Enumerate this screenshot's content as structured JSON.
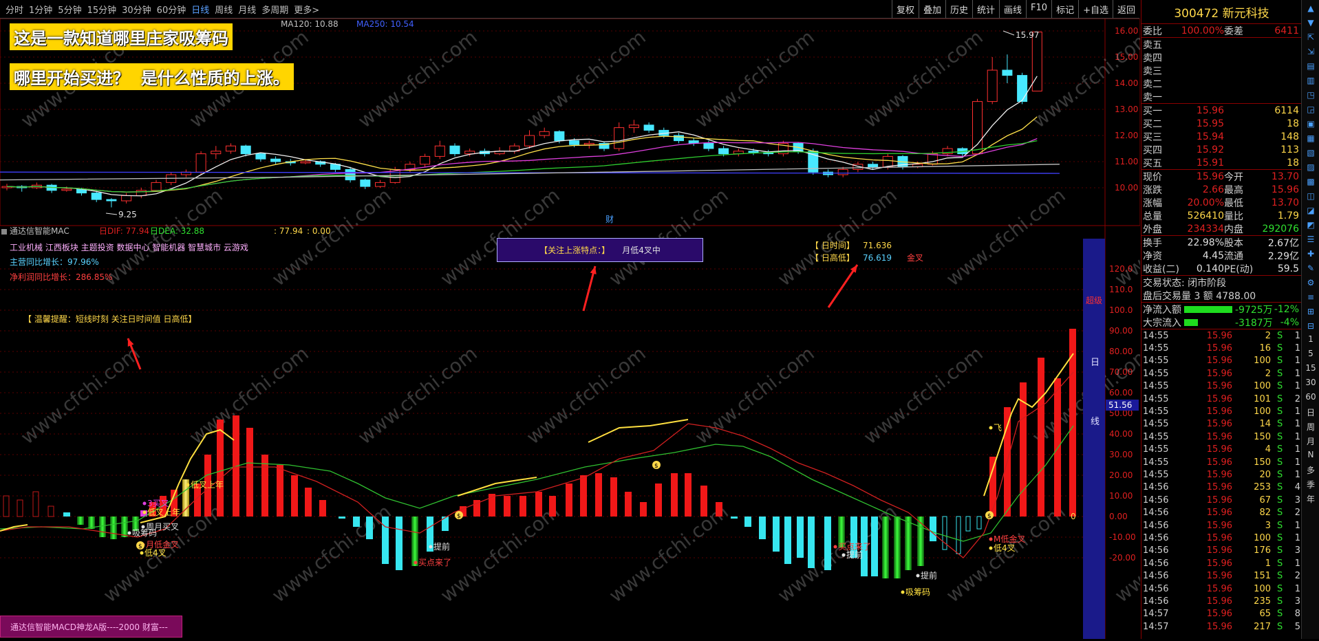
{
  "toolbar": {
    "periods": [
      "分时",
      "1分钟",
      "5分钟",
      "15分钟",
      "30分钟",
      "60分钟",
      "日线",
      "周线",
      "月线",
      "多周期",
      "更多>"
    ],
    "active": "日线",
    "tools": [
      "复权",
      "叠加",
      "历史",
      "统计",
      "画线",
      "F10",
      "标记",
      "+自选",
      "返回"
    ]
  },
  "banner": {
    "line1": "这是一款知道哪里庄家吸筹码",
    "line2": "哪里开始买进？  是什么性质的上涨。"
  },
  "main": {
    "ma_legend": {
      "ma120": "MA120: 10.88",
      "ma250": "MA250: 10.54"
    },
    "high_label": "15.97",
    "low_label": "9.25",
    "cai": "财"
  },
  "indicator": {
    "name": "通达信智能MAC",
    "legend": {
      "dif": "日DIF: 77.94",
      "dea": "日DEA: 32.88",
      "v1": ": 77.94",
      "v2": ": 0.00"
    },
    "sectors": "工业机械 江西板块 主题投资 数据中心 智能机器 智慧城市 云游戏",
    "rev": "主营同比增长：97.96%",
    "profit": "净利润同比增长：286.85%",
    "tip": "【 温馨提醒：短线时刻 关注日时间值 日高低】",
    "feature_label": "【关注上涨特点：】",
    "feature_value": "月低4叉中",
    "rishijian_label": "【 日时间】",
    "rishijian_value": "71.636",
    "rigaodi_label": "【 日高低】",
    "rigaodi_value": "76.619",
    "jincha": "金叉",
    "chaoji": "超级",
    "riline": [
      "日",
      "线"
    ],
    "current_value": "51.56",
    "zero": "0",
    "footer": "通达信智能MACD神龙A版----2000 财富---",
    "labels": {
      "dijiashang": "低叉上年",
      "zhoueyuexian": "周月买叉",
      "xichou1": "吸筹码",
      "di4cha1": "低4叉",
      "juyuejin": "月低金叉",
      "sanjian": "3买叉",
      "maidian": "买点来了",
      "tiqian1": "提前",
      "maidian2": "买点来了",
      "tiqian2": "提前",
      "tiqian3": "提前",
      "xichou2": "吸筹码",
      "yuedijin2": "M低金叉",
      "di4cha2": "低4叉",
      "fei": "飞"
    },
    "price_axis": [
      "16.00",
      "15.00",
      "14.00",
      "13.00",
      "12.00",
      "11.00",
      "10.00"
    ],
    "ind_axis": [
      "120.0",
      "110.0",
      "100.0",
      "90.00",
      "80.00",
      "70.00",
      "60.00",
      "50.00",
      "40.00",
      "30.00",
      "20.00",
      "10.00",
      "0.00",
      "-10.00",
      "-20.00"
    ]
  },
  "watermark": "www.cfchi.com",
  "quote": {
    "code_name": "300472 新元科技",
    "weibi": {
      "l": "委比",
      "v": "100.00%",
      "l2": "委差",
      "v2": "6411"
    },
    "sells": [
      "卖五",
      "卖四",
      "卖三",
      "卖二",
      "卖一"
    ],
    "buys": [
      {
        "l": "买一",
        "p": "15.96",
        "q": "6114"
      },
      {
        "l": "买二",
        "p": "15.95",
        "q": "18"
      },
      {
        "l": "买三",
        "p": "15.94",
        "q": "148"
      },
      {
        "l": "买四",
        "p": "15.92",
        "q": "113"
      },
      {
        "l": "买五",
        "p": "15.91",
        "q": "18"
      }
    ],
    "stats": [
      {
        "l": "现价",
        "v": "15.96",
        "l2": "今开",
        "v2": "13.70"
      },
      {
        "l": "涨跌",
        "v": "2.66",
        "l2": "最高",
        "v2": "15.96"
      },
      {
        "l": "涨幅",
        "v": "20.00%",
        "l2": "最低",
        "v2": "13.70"
      },
      {
        "l": "总量",
        "v": "526410",
        "l2": "量比",
        "v2": "1.79"
      },
      {
        "l": "外盘",
        "v": "234334",
        "l2": "内盘",
        "v2": "292076"
      }
    ],
    "stats2": [
      {
        "l": "换手",
        "v": "22.98%",
        "l2": "股本",
        "v2": "2.67亿"
      },
      {
        "l": "净资",
        "v": "4.45",
        "l2": "流通",
        "v2": "2.29亿"
      },
      {
        "l": "收益(二)",
        "v": "0.140",
        "l2": "PE(动)",
        "v2": "59.5"
      }
    ],
    "status": "交易状态: 闭市阶段",
    "after": "盘后交易量 3 额 4788.00",
    "flow1": {
      "l": "净流入额",
      "v": "-9725万",
      "p": "-12%"
    },
    "flow2": {
      "l": "大宗流入",
      "v": "-3187万",
      "p": "-4%"
    },
    "ticks": [
      {
        "t": "14:55",
        "p": "15.96",
        "q": "2",
        "s": "S",
        "n": "1"
      },
      {
        "t": "14:55",
        "p": "15.96",
        "q": "16",
        "s": "S",
        "n": "1"
      },
      {
        "t": "14:55",
        "p": "15.96",
        "q": "100",
        "s": "S",
        "n": "1"
      },
      {
        "t": "14:55",
        "p": "15.96",
        "q": "2",
        "s": "S",
        "n": "1"
      },
      {
        "t": "14:55",
        "p": "15.96",
        "q": "100",
        "s": "S",
        "n": "1"
      },
      {
        "t": "14:55",
        "p": "15.96",
        "q": "101",
        "s": "S",
        "n": "2"
      },
      {
        "t": "14:55",
        "p": "15.96",
        "q": "100",
        "s": "S",
        "n": "1"
      },
      {
        "t": "14:55",
        "p": "15.96",
        "q": "14",
        "s": "S",
        "n": "1"
      },
      {
        "t": "14:55",
        "p": "15.96",
        "q": "150",
        "s": "S",
        "n": "1"
      },
      {
        "t": "14:55",
        "p": "15.96",
        "q": "4",
        "s": "S",
        "n": "1"
      },
      {
        "t": "14:55",
        "p": "15.96",
        "q": "150",
        "s": "S",
        "n": "1"
      },
      {
        "t": "14:55",
        "p": "15.96",
        "q": "20",
        "s": "S",
        "n": "1"
      },
      {
        "t": "14:56",
        "p": "15.96",
        "q": "253",
        "s": "S",
        "n": "4"
      },
      {
        "t": "14:56",
        "p": "15.96",
        "q": "67",
        "s": "S",
        "n": "3"
      },
      {
        "t": "14:56",
        "p": "15.96",
        "q": "82",
        "s": "S",
        "n": "2"
      },
      {
        "t": "14:56",
        "p": "15.96",
        "q": "3",
        "s": "S",
        "n": "1"
      },
      {
        "t": "14:56",
        "p": "15.96",
        "q": "100",
        "s": "S",
        "n": "1"
      },
      {
        "t": "14:56",
        "p": "15.96",
        "q": "176",
        "s": "S",
        "n": "3"
      },
      {
        "t": "14:56",
        "p": "15.96",
        "q": "1",
        "s": "S",
        "n": "1"
      },
      {
        "t": "14:56",
        "p": "15.96",
        "q": "151",
        "s": "S",
        "n": "2"
      },
      {
        "t": "14:56",
        "p": "15.96",
        "q": "100",
        "s": "S",
        "n": "1"
      },
      {
        "t": "14:56",
        "p": "15.96",
        "q": "235",
        "s": "S",
        "n": "3"
      },
      {
        "t": "14:57",
        "p": "15.96",
        "q": "65",
        "s": "S",
        "n": "8"
      },
      {
        "t": "14:57",
        "p": "15.96",
        "q": "217",
        "s": "S",
        "n": "5"
      }
    ]
  },
  "sidebar": {
    "cap": [
      "日",
      "周",
      "月",
      "N",
      "多",
      "季",
      "年"
    ],
    "nums": [
      "1",
      "5",
      "15",
      "30",
      "60"
    ]
  }
}
